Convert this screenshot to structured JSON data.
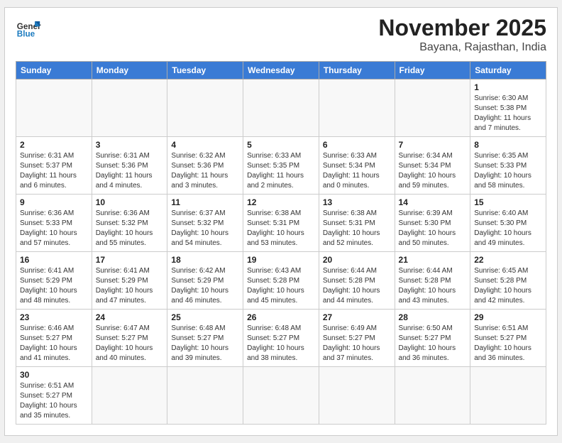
{
  "header": {
    "logo_general": "General",
    "logo_blue": "Blue",
    "month_title": "November 2025",
    "subtitle": "Bayana, Rajasthan, India"
  },
  "weekdays": [
    "Sunday",
    "Monday",
    "Tuesday",
    "Wednesday",
    "Thursday",
    "Friday",
    "Saturday"
  ],
  "weeks": [
    [
      {
        "day": "",
        "info": ""
      },
      {
        "day": "",
        "info": ""
      },
      {
        "day": "",
        "info": ""
      },
      {
        "day": "",
        "info": ""
      },
      {
        "day": "",
        "info": ""
      },
      {
        "day": "",
        "info": ""
      },
      {
        "day": "1",
        "info": "Sunrise: 6:30 AM\nSunset: 5:38 PM\nDaylight: 11 hours\nand 7 minutes."
      }
    ],
    [
      {
        "day": "2",
        "info": "Sunrise: 6:31 AM\nSunset: 5:37 PM\nDaylight: 11 hours\nand 6 minutes."
      },
      {
        "day": "3",
        "info": "Sunrise: 6:31 AM\nSunset: 5:36 PM\nDaylight: 11 hours\nand 4 minutes."
      },
      {
        "day": "4",
        "info": "Sunrise: 6:32 AM\nSunset: 5:36 PM\nDaylight: 11 hours\nand 3 minutes."
      },
      {
        "day": "5",
        "info": "Sunrise: 6:33 AM\nSunset: 5:35 PM\nDaylight: 11 hours\nand 2 minutes."
      },
      {
        "day": "6",
        "info": "Sunrise: 6:33 AM\nSunset: 5:34 PM\nDaylight: 11 hours\nand 0 minutes."
      },
      {
        "day": "7",
        "info": "Sunrise: 6:34 AM\nSunset: 5:34 PM\nDaylight: 10 hours\nand 59 minutes."
      },
      {
        "day": "8",
        "info": "Sunrise: 6:35 AM\nSunset: 5:33 PM\nDaylight: 10 hours\nand 58 minutes."
      }
    ],
    [
      {
        "day": "9",
        "info": "Sunrise: 6:36 AM\nSunset: 5:33 PM\nDaylight: 10 hours\nand 57 minutes."
      },
      {
        "day": "10",
        "info": "Sunrise: 6:36 AM\nSunset: 5:32 PM\nDaylight: 10 hours\nand 55 minutes."
      },
      {
        "day": "11",
        "info": "Sunrise: 6:37 AM\nSunset: 5:32 PM\nDaylight: 10 hours\nand 54 minutes."
      },
      {
        "day": "12",
        "info": "Sunrise: 6:38 AM\nSunset: 5:31 PM\nDaylight: 10 hours\nand 53 minutes."
      },
      {
        "day": "13",
        "info": "Sunrise: 6:38 AM\nSunset: 5:31 PM\nDaylight: 10 hours\nand 52 minutes."
      },
      {
        "day": "14",
        "info": "Sunrise: 6:39 AM\nSunset: 5:30 PM\nDaylight: 10 hours\nand 50 minutes."
      },
      {
        "day": "15",
        "info": "Sunrise: 6:40 AM\nSunset: 5:30 PM\nDaylight: 10 hours\nand 49 minutes."
      }
    ],
    [
      {
        "day": "16",
        "info": "Sunrise: 6:41 AM\nSunset: 5:29 PM\nDaylight: 10 hours\nand 48 minutes."
      },
      {
        "day": "17",
        "info": "Sunrise: 6:41 AM\nSunset: 5:29 PM\nDaylight: 10 hours\nand 47 minutes."
      },
      {
        "day": "18",
        "info": "Sunrise: 6:42 AM\nSunset: 5:29 PM\nDaylight: 10 hours\nand 46 minutes."
      },
      {
        "day": "19",
        "info": "Sunrise: 6:43 AM\nSunset: 5:28 PM\nDaylight: 10 hours\nand 45 minutes."
      },
      {
        "day": "20",
        "info": "Sunrise: 6:44 AM\nSunset: 5:28 PM\nDaylight: 10 hours\nand 44 minutes."
      },
      {
        "day": "21",
        "info": "Sunrise: 6:44 AM\nSunset: 5:28 PM\nDaylight: 10 hours\nand 43 minutes."
      },
      {
        "day": "22",
        "info": "Sunrise: 6:45 AM\nSunset: 5:28 PM\nDaylight: 10 hours\nand 42 minutes."
      }
    ],
    [
      {
        "day": "23",
        "info": "Sunrise: 6:46 AM\nSunset: 5:27 PM\nDaylight: 10 hours\nand 41 minutes."
      },
      {
        "day": "24",
        "info": "Sunrise: 6:47 AM\nSunset: 5:27 PM\nDaylight: 10 hours\nand 40 minutes."
      },
      {
        "day": "25",
        "info": "Sunrise: 6:48 AM\nSunset: 5:27 PM\nDaylight: 10 hours\nand 39 minutes."
      },
      {
        "day": "26",
        "info": "Sunrise: 6:48 AM\nSunset: 5:27 PM\nDaylight: 10 hours\nand 38 minutes."
      },
      {
        "day": "27",
        "info": "Sunrise: 6:49 AM\nSunset: 5:27 PM\nDaylight: 10 hours\nand 37 minutes."
      },
      {
        "day": "28",
        "info": "Sunrise: 6:50 AM\nSunset: 5:27 PM\nDaylight: 10 hours\nand 36 minutes."
      },
      {
        "day": "29",
        "info": "Sunrise: 6:51 AM\nSunset: 5:27 PM\nDaylight: 10 hours\nand 36 minutes."
      }
    ],
    [
      {
        "day": "30",
        "info": "Sunrise: 6:51 AM\nSunset: 5:27 PM\nDaylight: 10 hours\nand 35 minutes."
      },
      {
        "day": "",
        "info": ""
      },
      {
        "day": "",
        "info": ""
      },
      {
        "day": "",
        "info": ""
      },
      {
        "day": "",
        "info": ""
      },
      {
        "day": "",
        "info": ""
      },
      {
        "day": "",
        "info": ""
      }
    ]
  ]
}
